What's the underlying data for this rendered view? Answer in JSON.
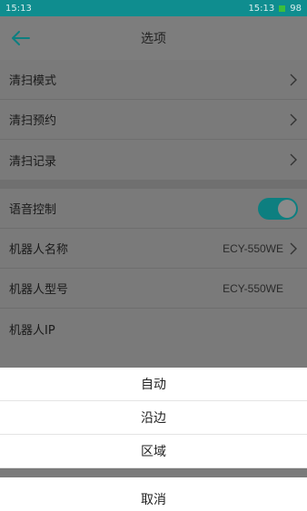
{
  "status_bar": {
    "time_left": "15:13",
    "time_right": "15:13",
    "battery": "98"
  },
  "header": {
    "title": "选项"
  },
  "groups": [
    {
      "rows": [
        {
          "label": "清扫模式",
          "value": ""
        },
        {
          "label": "清扫预约",
          "value": ""
        },
        {
          "label": "清扫记录",
          "value": ""
        }
      ]
    },
    {
      "rows": [
        {
          "label": "语音控制",
          "value": ""
        },
        {
          "label": "机器人名称",
          "value": "ECY-550WE"
        },
        {
          "label": "机器人型号",
          "value": "ECY-550WE"
        },
        {
          "label": "机器人IP",
          "value": ""
        }
      ]
    }
  ],
  "voice_toggle_on": true,
  "sheet": {
    "options": [
      "自动",
      "沿边",
      "区域"
    ],
    "cancel": "取消"
  }
}
